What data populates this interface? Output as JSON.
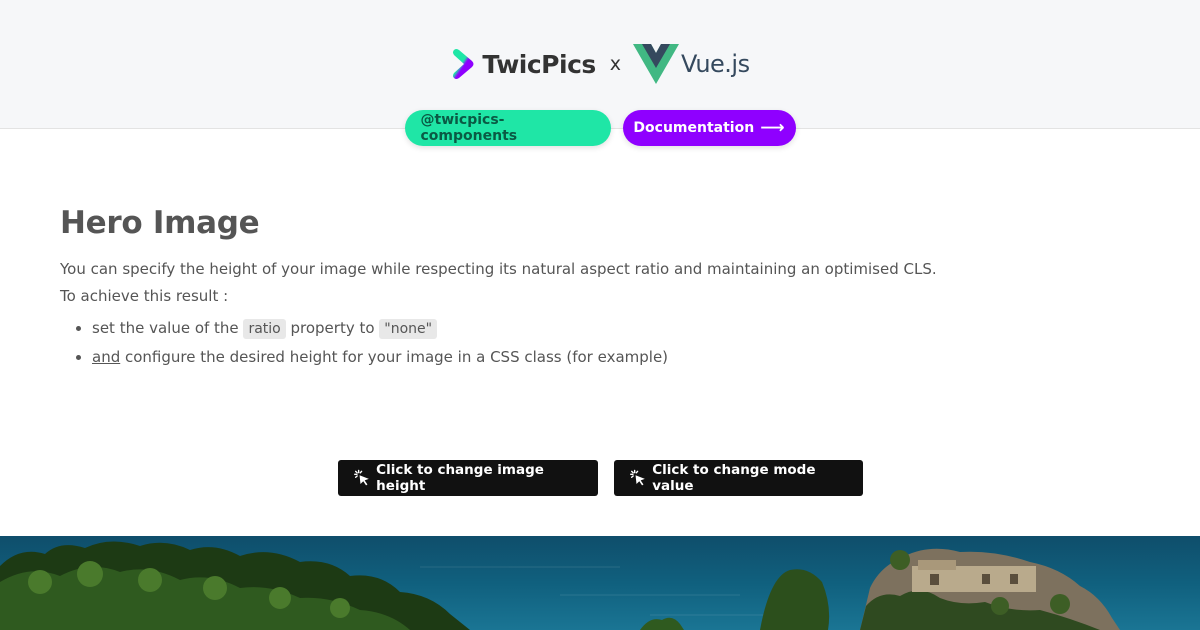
{
  "header": {
    "brand_name": "TwicPics",
    "separator": "x",
    "partner_name": "Vue.js",
    "pills": [
      {
        "label": "@twicpics-components"
      },
      {
        "label": "Documentation",
        "arrow": "⟶"
      }
    ]
  },
  "main": {
    "title": "Hero Image",
    "intro": "You can specify the height of your image while respecting its natural aspect ratio and maintaining an optimised CLS.",
    "lead": "To achieve this result :",
    "bullet1": {
      "prefix": "set the value of the ",
      "code1": "ratio",
      "middle": " property to ",
      "code2": "\"none\""
    },
    "bullet2": {
      "prefix": "and",
      "rest": " configure the desired height for your image in a CSS class (for example)"
    }
  },
  "actions": {
    "height_button": "Click to change image height",
    "mode_button": "Click to change mode value"
  },
  "colors": {
    "accent_green": "#1fe6a6",
    "accent_purple": "#8f00ff",
    "vue_green": "#41b883",
    "vue_dark": "#35495e"
  },
  "icons": [
    "twicpics-logo-icon",
    "vue-logo-icon",
    "cursor-click-icon",
    "arrow-right-icon"
  ]
}
